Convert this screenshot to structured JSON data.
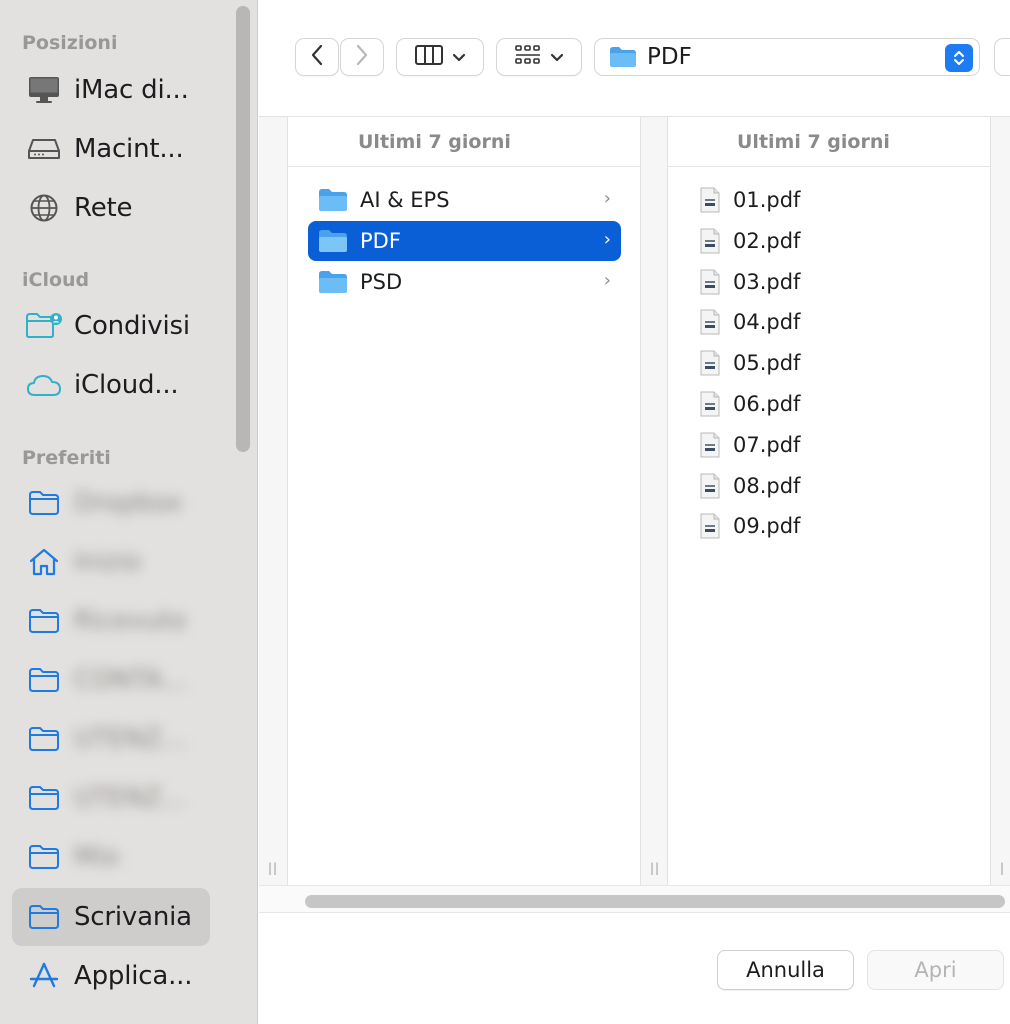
{
  "sidebar": {
    "sections": {
      "locations": "Posizioni",
      "icloud": "iCloud",
      "favorites": "Preferiti"
    },
    "locations": [
      {
        "label": "iMac di...",
        "icon": "desktop-computer-icon"
      },
      {
        "label": "Macint...",
        "icon": "hard-drive-icon"
      },
      {
        "label": "Rete",
        "icon": "globe-icon"
      }
    ],
    "icloud": [
      {
        "label": "Condivisi",
        "icon": "shared-folder-icon"
      },
      {
        "label": "iCloud...",
        "icon": "cloud-icon"
      }
    ],
    "favorites": [
      {
        "label": "Dropbox",
        "icon": "folder-icon",
        "blurred": true
      },
      {
        "label": "Inizio",
        "icon": "home-icon",
        "blurred": true
      },
      {
        "label": "Ricevuto",
        "icon": "folder-icon",
        "blurred": true
      },
      {
        "label": "CONTA...",
        "icon": "folder-icon",
        "blurred": true
      },
      {
        "label": "UTENZ...",
        "icon": "folder-icon",
        "blurred": true
      },
      {
        "label": "UTENZ...",
        "icon": "folder-icon",
        "blurred": true
      },
      {
        "label": "Mio",
        "icon": "folder-icon",
        "blurred": true
      },
      {
        "label": "Scrivania",
        "icon": "folder-icon",
        "blurred": false,
        "active": true
      },
      {
        "label": "Applica...",
        "icon": "app-store-icon",
        "blurred": false
      }
    ]
  },
  "toolbar": {
    "path_label": "PDF",
    "view_icon": "columns-view-icon",
    "group_icon": "grid-group-icon"
  },
  "columns": [
    {
      "header": "Ultimi 7 giorni",
      "items": [
        {
          "label": "AI & EPS",
          "type": "folder",
          "selected": false
        },
        {
          "label": "PDF",
          "type": "folder",
          "selected": true
        },
        {
          "label": "PSD",
          "type": "folder",
          "selected": false
        }
      ]
    },
    {
      "header": "Ultimi 7 giorni",
      "items": [
        {
          "label": "01.pdf",
          "type": "pdf"
        },
        {
          "label": "02.pdf",
          "type": "pdf"
        },
        {
          "label": "03.pdf",
          "type": "pdf"
        },
        {
          "label": "04.pdf",
          "type": "pdf"
        },
        {
          "label": "05.pdf",
          "type": "pdf"
        },
        {
          "label": "06.pdf",
          "type": "pdf"
        },
        {
          "label": "07.pdf",
          "type": "pdf"
        },
        {
          "label": "08.pdf",
          "type": "pdf"
        },
        {
          "label": "09.pdf",
          "type": "pdf"
        }
      ]
    }
  ],
  "footer": {
    "cancel_label": "Annulla",
    "open_label": "Apri"
  },
  "colors": {
    "accent": "#0a5fd6",
    "sidebar_icon": "#1f7be0",
    "folder": "#5aaef0",
    "icloud_icon": "#2fb1c8"
  }
}
